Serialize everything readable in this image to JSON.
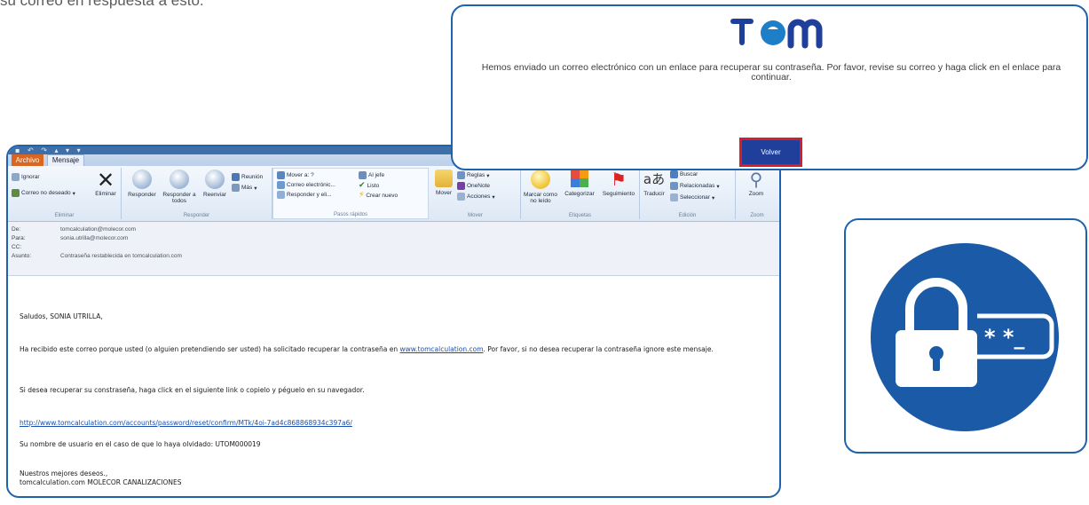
{
  "caption": "su correo en respuesta a esto.",
  "tom": {
    "message": "Hemos enviado un correo electrónico con un enlace para recuperar su contraseña. Por favor, revise su correo y haga click en el enlace para continuar.",
    "button": "Volver",
    "colors": {
      "navy": "#1f3f9a",
      "accent_red": "#d51e2a",
      "border_blue": "#1f63ad"
    }
  },
  "outlook": {
    "tabs": {
      "file": "Archivo",
      "message": "Mensaje"
    },
    "ribbon": {
      "ignore": "Ignorar",
      "junk": "Correo no deseado",
      "delete": "Eliminar",
      "reply": "Responder",
      "reply_all": "Responder a todos",
      "forward": "Reenviar",
      "meeting": "Reunión",
      "more": "Más",
      "move_to": "Mover a: ?",
      "team_email": "Correo electrónic...",
      "reply_delete": "Responder y eli...",
      "to_manager": "Al jefe",
      "done": "Listo",
      "create_new": "Crear nuevo",
      "move": "Mover",
      "rules": "Reglas",
      "onenote": "OneNote",
      "actions": "Acciones",
      "mark_unread": "Marcar como no leído",
      "categorize": "Categorizar",
      "followup": "Seguimiento",
      "translate": "Traducir",
      "find": "Buscar",
      "related": "Relacionadas",
      "select": "Seleccionar",
      "zoom": "Zoom",
      "groups": {
        "delete": "Eliminar",
        "respond": "Responder",
        "quick_steps": "Pasos rápidos",
        "move": "Mover",
        "tags": "Etiquetas",
        "editing": "Edición",
        "zoom": "Zoom"
      }
    },
    "header": {
      "from_label": "De:",
      "from": "tomcalculation@molecor.com",
      "to_label": "Para:",
      "to": "sonia.utrilla@molecor.com",
      "cc_label": "CC:",
      "subject_label": "Asunto:",
      "subject": "Contraseña restablecida en tomcalculation.com"
    },
    "body": {
      "greeting": "Saludos, SONIA UTRILLA,",
      "p1_pre": "Ha recibido este correo porque usted (o alguien pretendiendo ser usted) ha solicitado recuperar la contraseña en ",
      "p1_link": "www.tomcalculation.com",
      "p1_post": ". Por favor, si no desea recuperar la contraseña ignore este mensaje.",
      "p2": "Si desea recuperar su constraseña, haga click en el siguiente link o copielo y péguelo en su navegador.",
      "reset_link": "http://www.tomcalculation.com/accounts/password/reset/confirm/MTk/4oi-7ad4c868868934c397a6/",
      "username": "Su nombre de usuario en el caso de que lo haya olvidado: UTOM000019",
      "closing": "Nuestros mejores deseos.,",
      "signature": "tomcalculation.com MOLECOR CANALIZACIONES"
    }
  },
  "lock_icon": {
    "password_mask": "* *_",
    "colors": {
      "circle": "#1b5aa6",
      "lock": "#ffffff"
    }
  }
}
